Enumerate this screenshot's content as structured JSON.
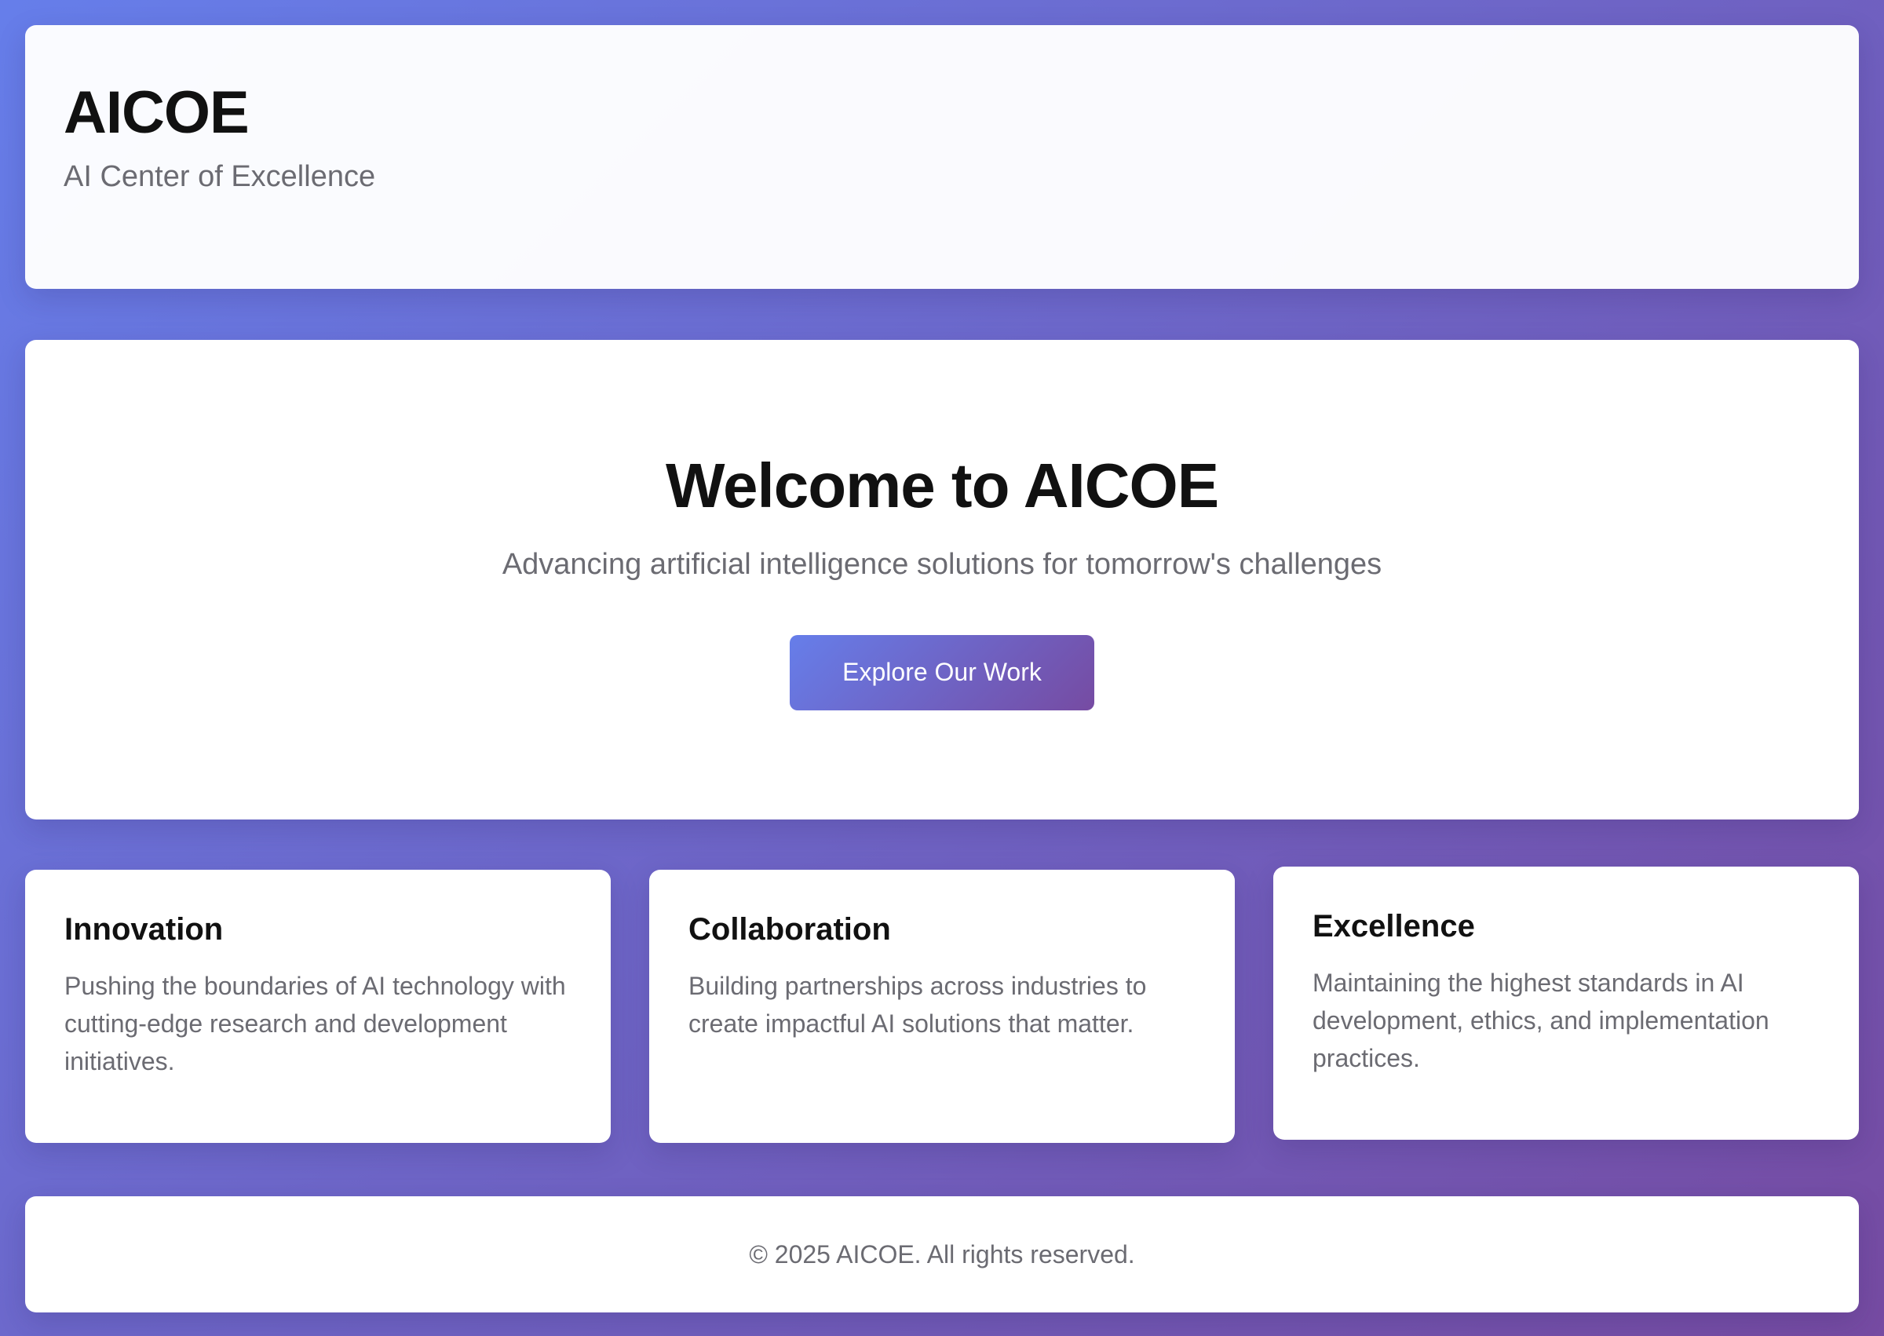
{
  "header": {
    "title": "AICOE",
    "subtitle": "AI Center of Excellence"
  },
  "hero": {
    "title": "Welcome to AICOE",
    "subtitle": "Advancing artificial intelligence solutions for tomorrow's challenges",
    "cta_label": "Explore Our Work"
  },
  "features": [
    {
      "title": "Innovation",
      "text": "Pushing the boundaries of AI technology with cutting-edge research and development initiatives."
    },
    {
      "title": "Collaboration",
      "text": "Building partnerships across industries to create impactful AI solutions that matter."
    },
    {
      "title": "Excellence",
      "text": "Maintaining the highest standards in AI development, ethics, and implementation practices."
    }
  ],
  "footer": {
    "copyright": "© 2025 AICOE. All rights reserved."
  },
  "colors": {
    "gradient_start": "#667eea",
    "gradient_end": "#764ba2",
    "heading": "#111111",
    "muted_text": "#6b6b72",
    "card_background": "#ffffff"
  }
}
